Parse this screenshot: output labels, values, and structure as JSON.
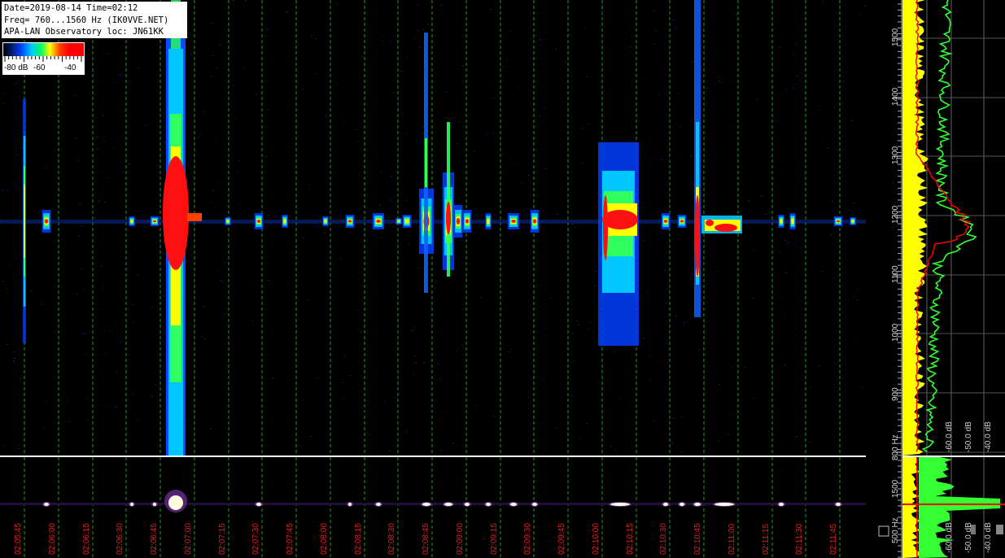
{
  "info": {
    "line1": "Date=2019-08-14 Time=02:12",
    "line2": "Freq= 760...1560 Hz (IK0VVE.NET)",
    "line3": "APA-LAN Observatory loc: JN61KK"
  },
  "colorbar": {
    "label_low": "-80 dB",
    "label_mid": "-60",
    "label_high": "-40"
  },
  "freq_axis": {
    "labels": [
      "1500",
      "1400",
      "1300",
      "1200",
      "1100",
      "1000",
      "900",
      "800 Hz"
    ]
  },
  "lower_freq_axis": {
    "labels": [
      "1500",
      "500 Hz"
    ]
  },
  "spectrum_db_labels": [
    "-60.0 dB",
    "-50.0 dB",
    "-40.0 dB"
  ],
  "lower_db_labels": [
    "-60.0 dB",
    "-50.0 dB",
    "-40.0 dB"
  ],
  "time_labels": [
    "02:05:45",
    "02:06:00",
    "02:06:15",
    "02:06:30",
    "02:06:45",
    "02:07:00",
    "02:07:15",
    "02:07:30",
    "02:07:45",
    "02:08:00",
    "02:08:15",
    "02:08:30",
    "02:08:45",
    "02:09:00",
    "02:09:15",
    "02:09:30",
    "02:09:45",
    "02:10:00",
    "02:10:15",
    "02:10:30",
    "02:10:45",
    "02:11:00",
    "02:11:15",
    "02:11:30",
    "02:11:45"
  ],
  "colors": {
    "grid_green": "#1f9e1f",
    "time_label_red": "#e02020",
    "spectrum_yellow": "#ffff00",
    "spectrum_green": "#33ff33",
    "spectrum_red": "#ff0000"
  }
}
